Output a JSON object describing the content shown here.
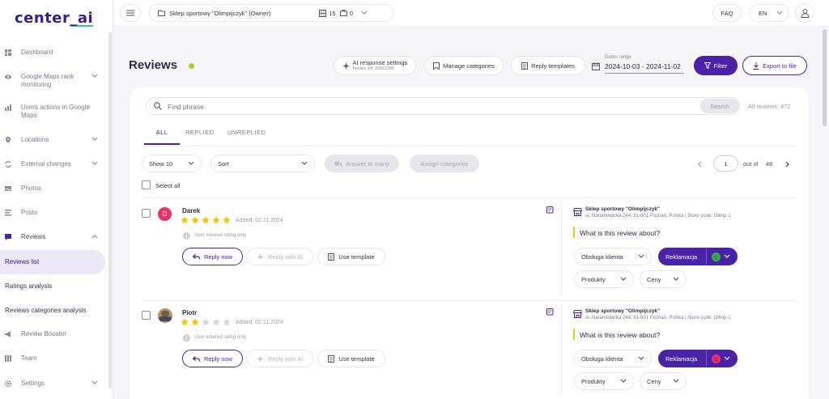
{
  "brand": {
    "logo_main": "center",
    "logo_u": "_ai"
  },
  "sidebar": {
    "items": [
      {
        "label": "Dashboard",
        "icon": "dashboard-icon"
      },
      {
        "label": "Google Maps rank monitoring",
        "icon": "eye-icon"
      },
      {
        "label": "Users actions in Google Maps",
        "icon": "chart-icon"
      },
      {
        "label": "Locations",
        "icon": "pin-icon"
      },
      {
        "label": "External changes",
        "icon": "sync-icon"
      },
      {
        "label": "Photos",
        "icon": "image-icon"
      },
      {
        "label": "Posts",
        "icon": "posts-icon"
      },
      {
        "label": "Reviews",
        "icon": "chat-icon"
      },
      {
        "label": "Review Booster",
        "icon": "megaphone-icon"
      },
      {
        "label": "Team",
        "icon": "team-icon"
      },
      {
        "label": "Settings",
        "icon": "gear-icon"
      }
    ],
    "subitems": [
      "Reviews list",
      "Ratings analysis",
      "Reviews categories analysis"
    ]
  },
  "topbar": {
    "store": "Sklep sportowy \"Olimpijczyk\" (Owner)",
    "count_a": "15",
    "count_b": "0",
    "faq": "FAQ",
    "lang": "EN"
  },
  "header": {
    "title": "Reviews",
    "status_color": "#a3d12b",
    "ai_settings": "AI response settings",
    "ai_sub": "Replies left: 1000/1000",
    "manage_categories": "Manage categories",
    "reply_templates": "Reply templates",
    "dates_label": "Dates range",
    "dates_value": "2024-10-03 - 2024-11-02",
    "filter": "Filter",
    "export": "Export to file"
  },
  "search": {
    "placeholder": "Find phrase",
    "button": "Search",
    "all_reviews": "All reviews: 472"
  },
  "tabs": [
    "ALL",
    "REPLIED",
    "UNREPLIED"
  ],
  "toolbar": {
    "show": "Show 10",
    "sort": "Sort",
    "answer_many": "Answer to many",
    "assign": "Assign categories",
    "page": "1",
    "out_of": "out of",
    "total_pages": "48",
    "select_all": "Select all"
  },
  "reviews": [
    {
      "author": "Darek",
      "initial": "D",
      "rating": 5,
      "added": "Added: 02.11.2024",
      "note": "User entered rating only",
      "reply_now": "Reply now",
      "reply_ai": "Reply with AI",
      "use_template": "Use template",
      "store_name": "Sklep sportowy \"Olimpijczyk\"",
      "store_addr": "ul. Naramowicka 244, 61-601 Poznań, Polska | Store code: Olimp-1",
      "question": "What is this review about?",
      "tags": [
        "Obsługa klienta",
        "Reklamacja",
        "Produkty",
        "Ceny"
      ],
      "sentiment": "positive"
    },
    {
      "author": "Piotr",
      "initial": "P",
      "rating": 2,
      "added": "Added: 02.11.2024",
      "note": "User entered rating only",
      "reply_now": "Reply now",
      "reply_ai": "Reply with AI",
      "use_template": "Use template",
      "store_name": "Sklep sportowy \"Olimpijczyk\"",
      "store_addr": "ul. Naramowicka 244, 61-601 Poznań, Polska | Store code: Olimp-1",
      "question": "What is this review about?",
      "tags": [
        "Obsługa klienta",
        "Reklamacja",
        "Produkty",
        "Ceny"
      ],
      "sentiment": "negative"
    }
  ],
  "colors": {
    "primary": "#4a22a8",
    "star": "#f2c40f",
    "star_empty": "#d5d5dc",
    "positive": "#34b048",
    "negative": "#e8326b"
  }
}
